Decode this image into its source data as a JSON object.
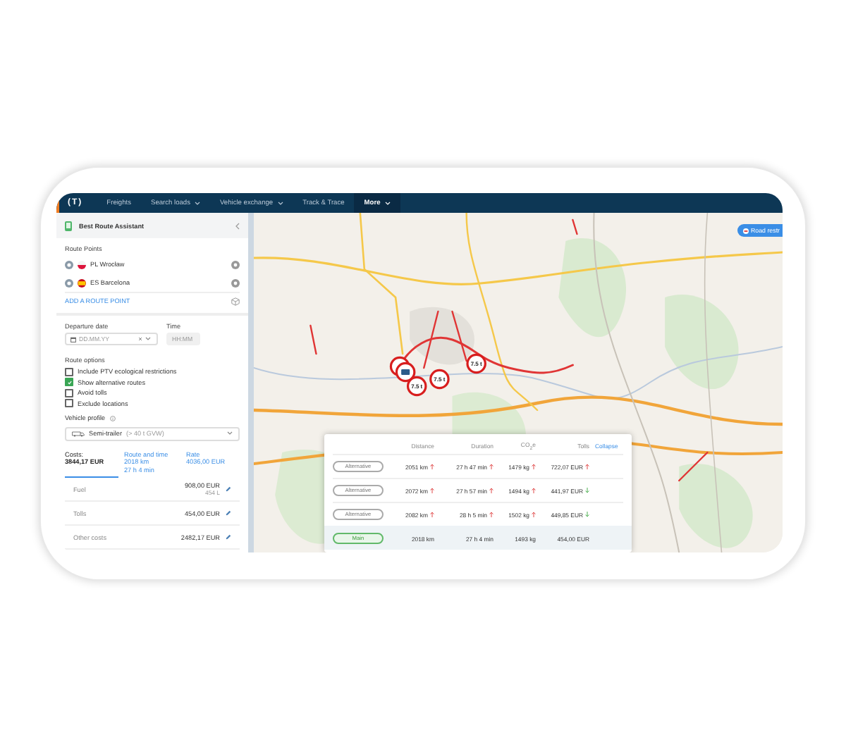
{
  "nav": {
    "logo": "(T)",
    "items": [
      {
        "label": "Freights",
        "dropdown": false,
        "selected": false
      },
      {
        "label": "Search loads",
        "dropdown": true,
        "selected": false
      },
      {
        "label": "Vehicle exchange",
        "dropdown": true,
        "selected": false
      },
      {
        "label": "Track & Trace",
        "dropdown": false,
        "selected": false
      },
      {
        "label": "More",
        "dropdown": true,
        "selected": true
      }
    ]
  },
  "sidebar": {
    "title": "Best Route Assistant",
    "route_points": {
      "heading": "Route Points",
      "points": [
        {
          "kind": "pl",
          "place": "PL Wrocław"
        },
        {
          "kind": "es",
          "place": "ES Barcelona"
        }
      ],
      "add": "ADD A ROUTE POINT"
    },
    "departure_date": {
      "label": "Departure date",
      "placeholder": "DD.MM.YY"
    },
    "time": {
      "label": "Time",
      "placeholder": "HH:MM"
    },
    "route_options": {
      "heading": "Route options",
      "options": [
        {
          "label": "Include PTV ecological restrictions",
          "checked": false
        },
        {
          "label": "Show alternative routes",
          "checked": true
        },
        {
          "label": "Avoid tolls",
          "checked": false
        },
        {
          "label": "Exclude locations",
          "checked": false
        }
      ]
    },
    "vehicle_profile": {
      "label": "Vehicle profile",
      "value": "Semi-trailer",
      "hint": "(> 40 t GVW)"
    },
    "tabs": [
      {
        "title": "Costs:",
        "lines": [
          "3844,17 EUR"
        ],
        "selected": true
      },
      {
        "title": "Route and time",
        "lines": [
          "2018 km",
          "27 h 4 min"
        ],
        "selected": false
      },
      {
        "title": "Rate",
        "lines": [
          "4036,00 EUR"
        ],
        "selected": false
      }
    ],
    "costs": [
      {
        "label": "Fuel",
        "value": "908,00 EUR",
        "detail": "454 L"
      },
      {
        "label": "Tolls",
        "value": "454,00 EUR"
      },
      {
        "label": "Other costs",
        "value": "2482,17 EUR"
      }
    ]
  },
  "map": {
    "road_restrictions": "Road restr",
    "weight_limits": [
      "7.5 t",
      "7.5 t",
      "7.5 t"
    ]
  },
  "routes_table": {
    "columns": [
      "Distance",
      "Duration",
      "CO$_{2}$e",
      "Tolls"
    ],
    "collapse": "Collapse",
    "rows": [
      {
        "kind": "alternative",
        "label": "Alternative",
        "selected": false,
        "cells": [
          {
            "text": "2051 km",
            "kind": "up"
          },
          {
            "text": "27 h 47 min",
            "kind": "up"
          },
          {
            "text": "1479 kg",
            "kind": "up"
          },
          {
            "text": "722,07 EUR",
            "kind": "up"
          }
        ]
      },
      {
        "kind": "alternative",
        "label": "Alternative",
        "selected": false,
        "cells": [
          {
            "text": "2072 km",
            "kind": "up"
          },
          {
            "text": "27 h 57 min",
            "kind": "up"
          },
          {
            "text": "1494 kg",
            "kind": "up"
          },
          {
            "text": "441,97 EUR",
            "kind": "down"
          }
        ]
      },
      {
        "kind": "alternative",
        "label": "Alternative",
        "selected": false,
        "cells": [
          {
            "text": "2082 km",
            "kind": "up"
          },
          {
            "text": "28 h 5 min",
            "kind": "up"
          },
          {
            "text": "1502 kg",
            "kind": "up"
          },
          {
            "text": "449,85 EUR",
            "kind": "down"
          }
        ]
      },
      {
        "kind": "main",
        "label": "Main",
        "selected": true,
        "cells": [
          {
            "text": "2018 km",
            "kind": "plain"
          },
          {
            "text": "27 h 4 min",
            "kind": "plain"
          },
          {
            "text": "1493 kg",
            "kind": "plain"
          },
          {
            "text": "454,00 EUR",
            "kind": "plain"
          }
        ]
      }
    ]
  }
}
